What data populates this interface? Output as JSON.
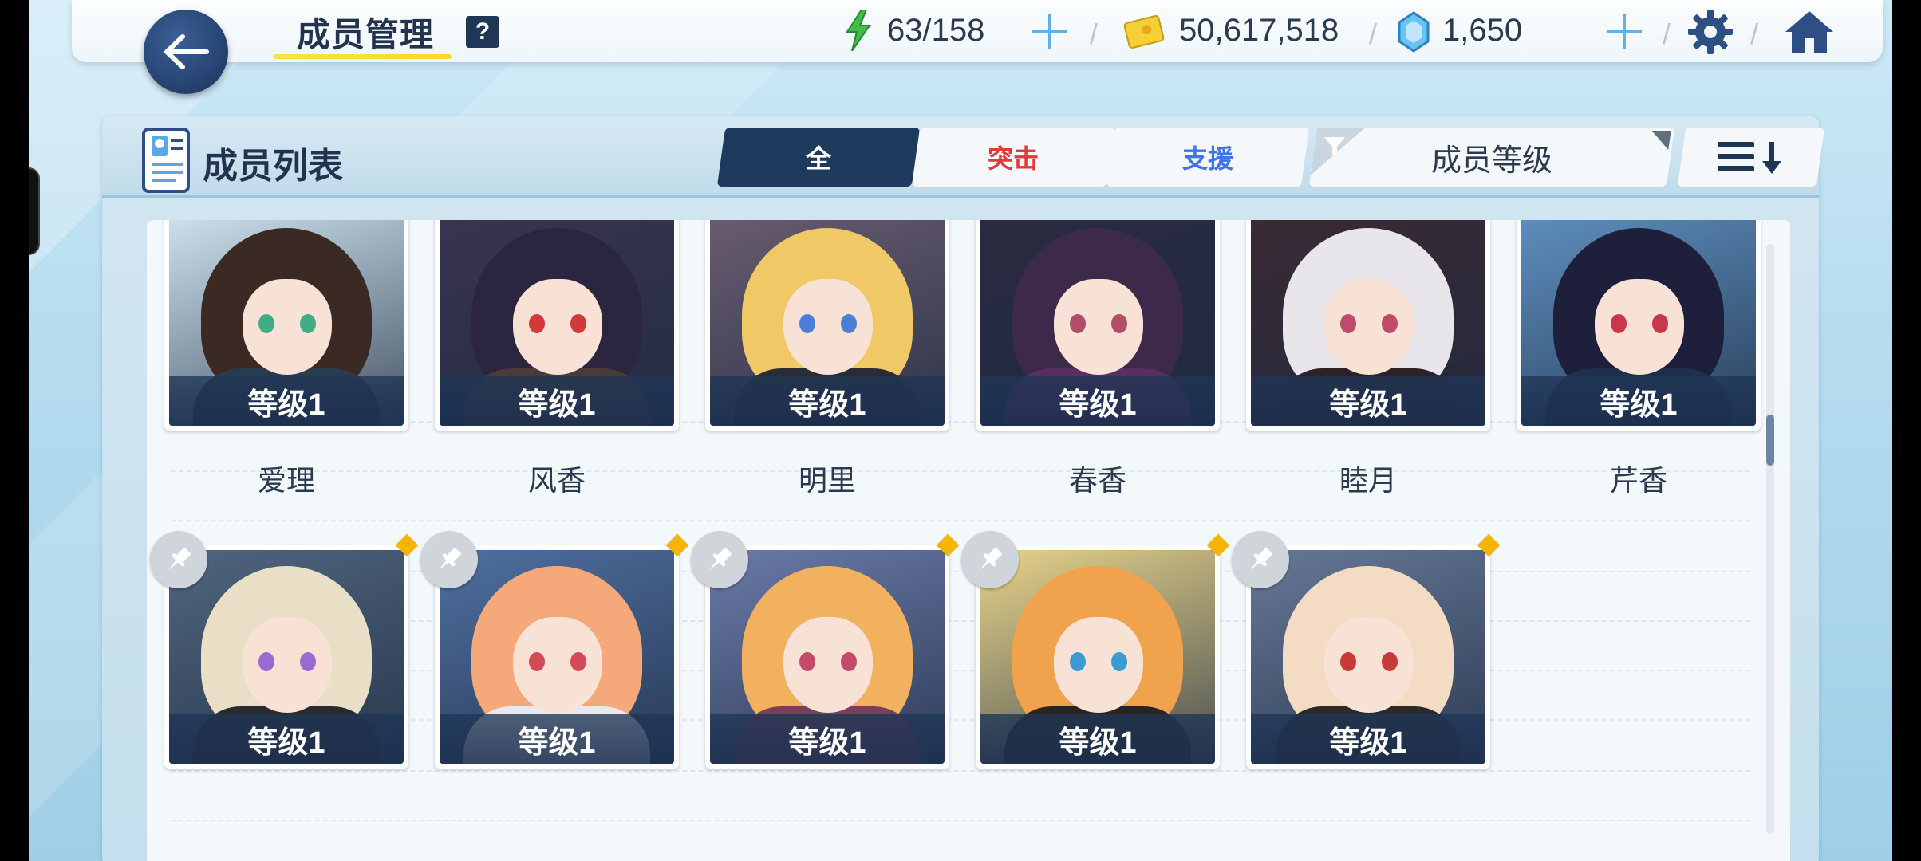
{
  "header": {
    "title": "成员管理",
    "help_label": "?",
    "stamina": "63/158",
    "credits": "50,617,518",
    "pyroxene": "1,650"
  },
  "panel": {
    "title": "成员列表",
    "tabs": [
      {
        "label": "全",
        "active": true,
        "color": "#ffffff"
      },
      {
        "label": "突击",
        "active": false,
        "color": "#e03b3b"
      },
      {
        "label": "支援",
        "active": false,
        "color": "#3f73e8"
      }
    ],
    "sort_label": "成员等级"
  },
  "members_row1": [
    {
      "name": "爱理",
      "level": "等级1",
      "hair": "#3b2a24",
      "eye": "#3fae86",
      "bg": "#cfe3ee",
      "body": "#2a3b4e"
    },
    {
      "name": "风香",
      "level": "等级1",
      "hair": "#2b2540",
      "eye": "#d23a3a",
      "bg": "#3a3450",
      "body": "#4a3a3a"
    },
    {
      "name": "明里",
      "level": "等级1",
      "hair": "#f0c865",
      "eye": "#4a7fd8",
      "bg": "#6a5c70",
      "body": "#2c2c34"
    },
    {
      "name": "春香",
      "level": "等级1",
      "hair": "#3d2a4a",
      "eye": "#b04f6a",
      "bg": "#2a2a40",
      "body": "#5a2e60"
    },
    {
      "name": "睦月",
      "level": "等级1",
      "hair": "#e8e6ea",
      "eye": "#c04a6a",
      "bg": "#3a2a34",
      "body": "#2c2228"
    },
    {
      "name": "芹香",
      "level": "等级1",
      "hair": "#1e1f3a",
      "eye": "#c8374a",
      "bg": "#5e8fbf",
      "body": "#1f2e4a"
    }
  ],
  "members_row2": [
    {
      "level": "等级1",
      "hair": "#e8dfc6",
      "eye": "#9a6ad0",
      "bg": "#50657e",
      "body": "#2a2a30"
    },
    {
      "level": "等级1",
      "hair": "#f5a97a",
      "eye": "#d44a56",
      "bg": "#4f6fa0",
      "body": "#e8e8ee"
    },
    {
      "level": "等级1",
      "hair": "#f1b15e",
      "eye": "#c44a6a",
      "bg": "#6a7aa8",
      "body": "#7a3e58"
    },
    {
      "level": "等级1",
      "hair": "#f0a24c",
      "eye": "#3b9ad0",
      "bg": "#e6d28a",
      "body": "#2a2420"
    },
    {
      "level": "等级1",
      "hair": "#f4dcc4",
      "eye": "#c83a3a",
      "bg": "#667896",
      "body": "#2a2a2c"
    }
  ]
}
